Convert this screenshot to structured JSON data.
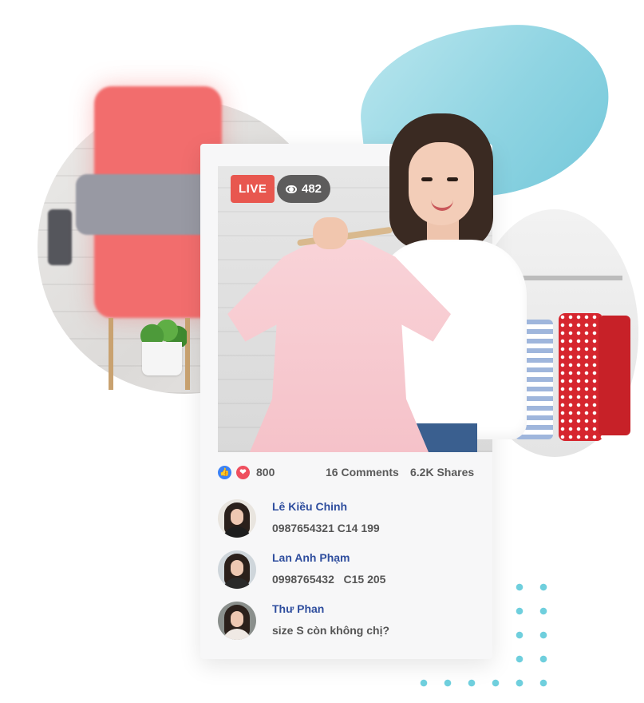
{
  "live_badge": "LIVE",
  "views": "482",
  "reactions": {
    "like_icon": "thumbs-up-icon",
    "love_icon": "heart-icon",
    "count": "800"
  },
  "comments_count": "16 Comments",
  "shares_count": "6.2K Shares",
  "comments": [
    {
      "name": "Lê Kiều Chinh",
      "text": "0987654321 C14 199"
    },
    {
      "name": "Lan Anh Phạm",
      "text": "0998765432   C15 205"
    },
    {
      "name": "Thư Phan",
      "text": "size S còn không chị?"
    }
  ],
  "colors": {
    "live_red": "#e8574f",
    "name_blue": "#2f4e9e",
    "accent_teal": "#6fcfdd",
    "blob_teal": "#8fd4e2"
  }
}
